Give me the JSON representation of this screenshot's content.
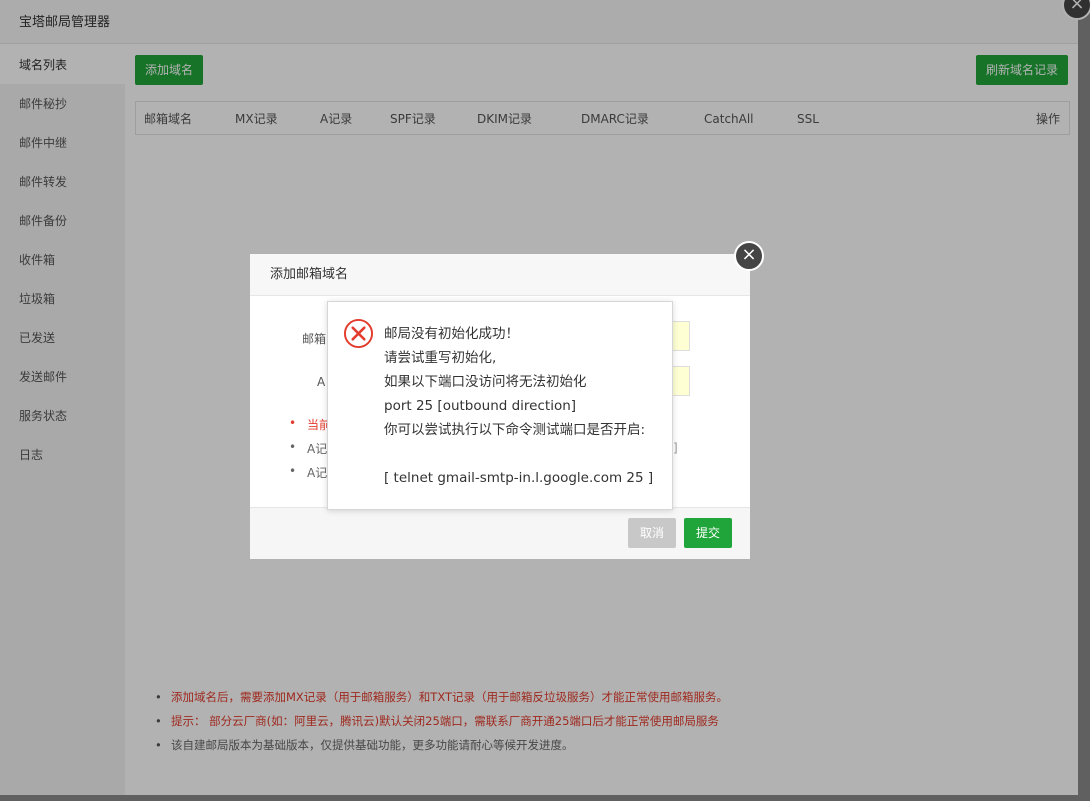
{
  "window": {
    "title": "宝塔邮局管理器"
  },
  "sidebar": {
    "items": [
      {
        "label": "域名列表"
      },
      {
        "label": "邮件秘抄"
      },
      {
        "label": "邮件中继"
      },
      {
        "label": "邮件转发"
      },
      {
        "label": "邮件备份"
      },
      {
        "label": "收件箱"
      },
      {
        "label": "垃圾箱"
      },
      {
        "label": "已发送"
      },
      {
        "label": "发送邮件"
      },
      {
        "label": "服务状态"
      },
      {
        "label": "日志"
      }
    ]
  },
  "toolbar": {
    "add_domain": "添加域名",
    "refresh_records": "刷新域名记录"
  },
  "table": {
    "columns": [
      "邮箱域名",
      "MX记录",
      "A记录",
      "SPF记录",
      "DKIM记录",
      "DMARC记录",
      "CatchAll",
      "SSL",
      "操作"
    ]
  },
  "notes": [
    "添加域名后，需要添加MX记录（用于邮箱服务）和TXT记录（用于邮箱反垃圾服务）才能正常使用邮箱服务。",
    "提示：  部分云厂商(如：阿里云，腾讯云)默认关闭25端口，需联系厂商开通25端口后才能正常使用邮局服务",
    "该自建邮局版本为基础版本，仅提供基础功能，更多功能请耐心等候开发进度。"
  ],
  "dialog": {
    "title": "添加邮箱域名",
    "label_domain": "邮箱",
    "label_a": "A",
    "bullet_1": "当前",
    "bullet_2": "A记",
    "bullet_3": "A记",
    "cancel": "取消",
    "submit": "提交"
  },
  "message": {
    "lines": [
      "邮局没有初始化成功！",
      "请尝试重写初始化,",
      "如果以下端口没访问将无法初始化",
      "port 25 [outbound direction]",
      "你可以尝试执行以下命令测试端口是否开启:",
      "",
      "[ telnet gmail-smtp-in.l.google.com 25 ]"
    ]
  },
  "colors": {
    "primary_green": "#20a53a",
    "error_red": "#e33b2c",
    "disabled_gray": "#c8c8c8"
  }
}
